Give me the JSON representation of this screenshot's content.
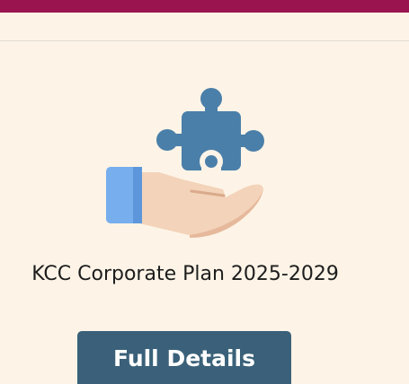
{
  "card": {
    "icon": "hand-holding-puzzle-piece-icon",
    "title": "KCC Corporate Plan 2025-2029",
    "button_label": "Full Details"
  },
  "colors": {
    "brand_bar": "#9a1550",
    "page_background": "#fdf4e7",
    "button_background": "#3a6179",
    "button_text": "#ffffff",
    "puzzle": "#4a7fa9",
    "cuff": "#77aeed",
    "hand": "#f3d3b9"
  }
}
